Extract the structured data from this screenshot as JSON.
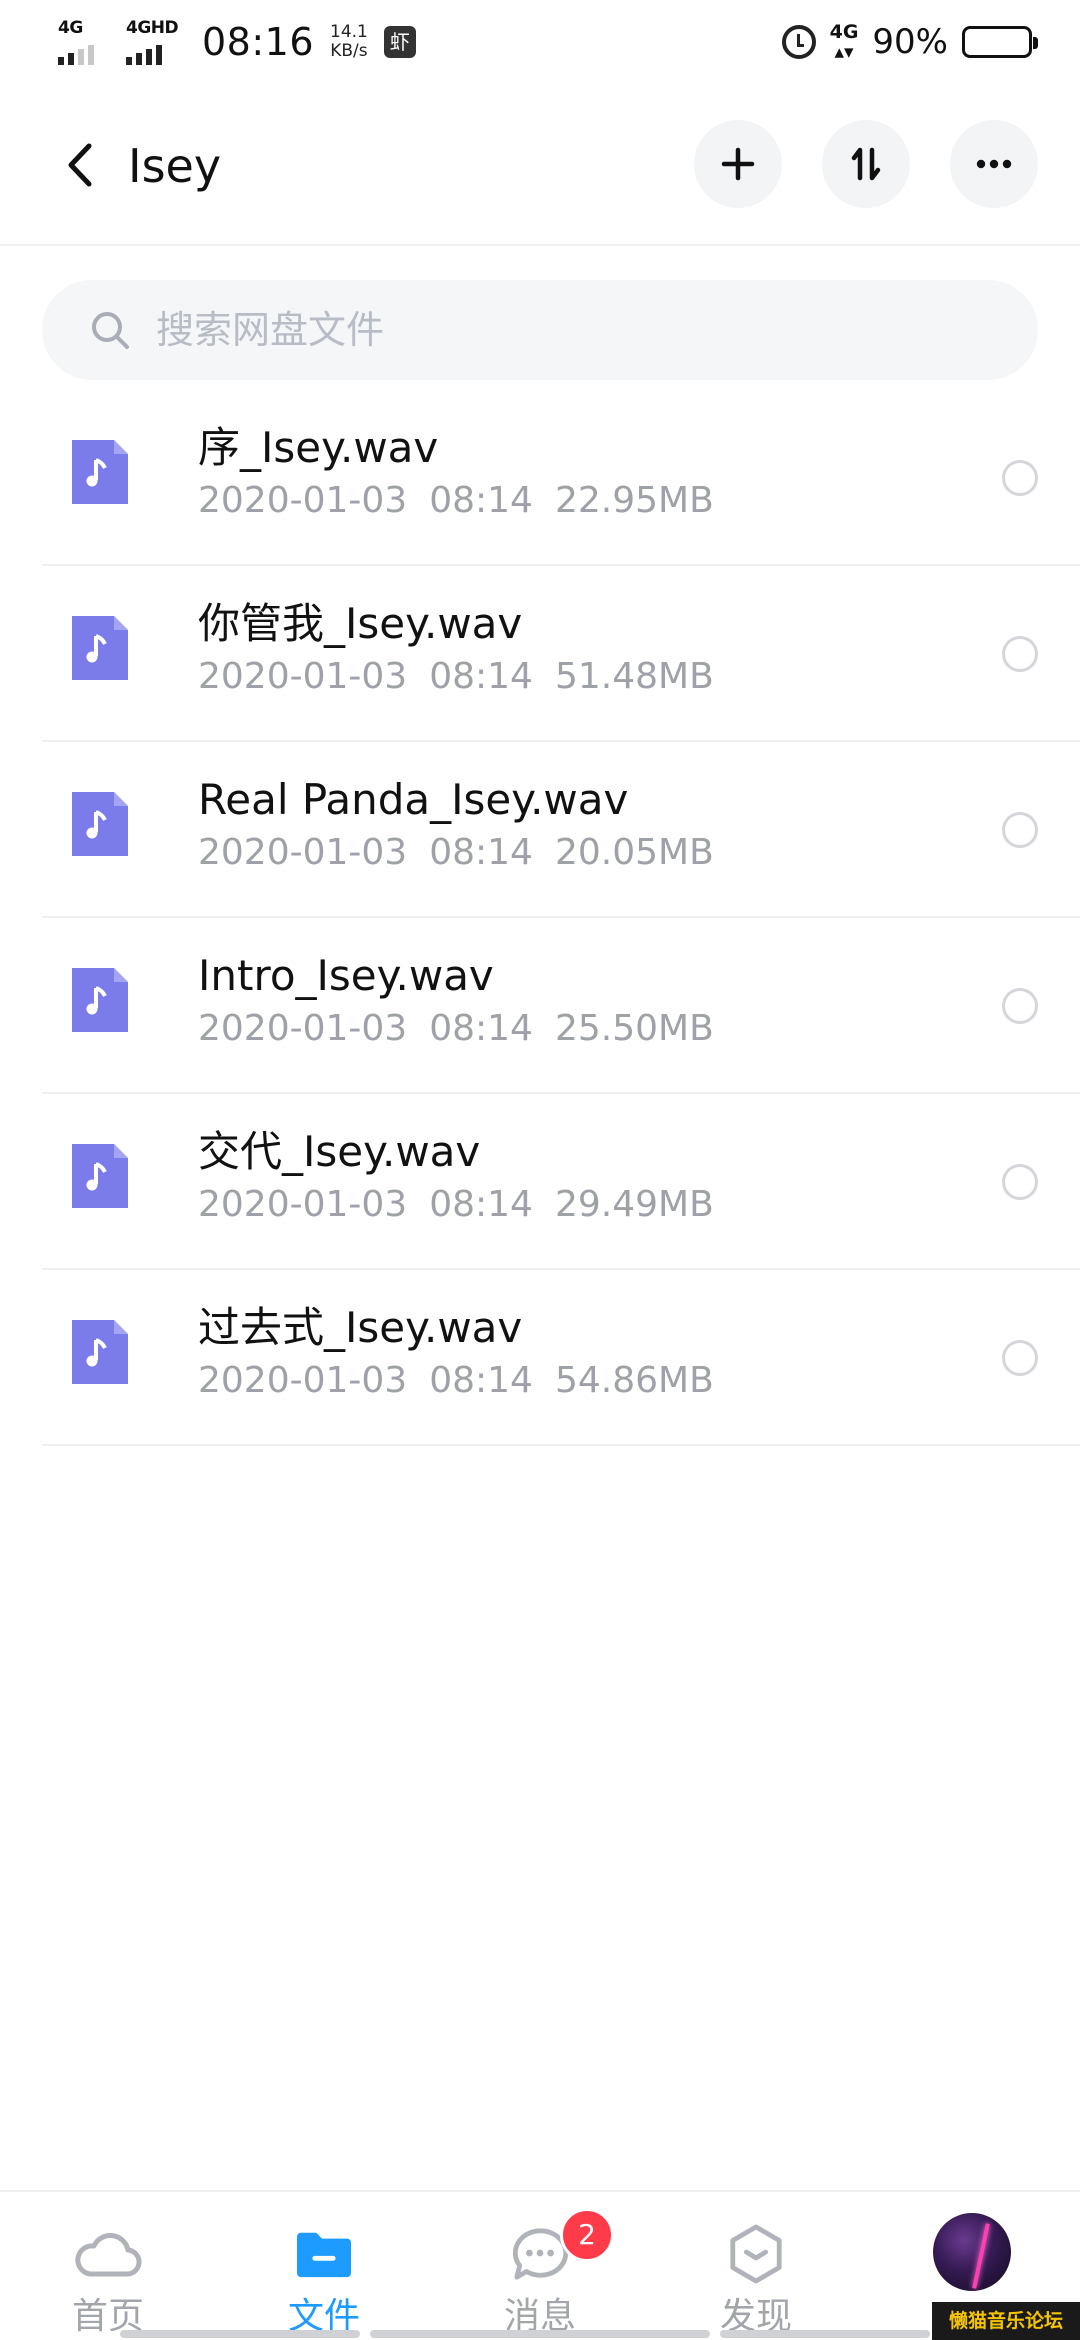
{
  "status_bar": {
    "network_1": "4G",
    "network_2": "4GHD",
    "time": "08:16",
    "speed_value": "14.1",
    "speed_unit": "KB/s",
    "app_glyph": "虾",
    "network_right": "4G",
    "battery_percent": "90%",
    "battery_level": 0.9
  },
  "header": {
    "back_icon": "chevron-left-icon",
    "title": "Isey",
    "actions": [
      "plus-icon",
      "sort-icon",
      "more-icon"
    ]
  },
  "search": {
    "placeholder": "搜索网盘文件",
    "value": ""
  },
  "files": [
    {
      "name": "序_Isey.wav",
      "date": "2020-01-03",
      "time": "08:14",
      "size": "22.95MB"
    },
    {
      "name": "你管我_Isey.wav",
      "date": "2020-01-03",
      "time": "08:14",
      "size": "51.48MB"
    },
    {
      "name": "Real Panda_Isey.wav",
      "date": "2020-01-03",
      "time": "08:14",
      "size": "20.05MB"
    },
    {
      "name": "Intro_Isey.wav",
      "date": "2020-01-03",
      "time": "08:14",
      "size": "25.50MB"
    },
    {
      "name": "交代_Isey.wav",
      "date": "2020-01-03",
      "time": "08:14",
      "size": "29.49MB"
    },
    {
      "name": "过去式_Isey.wav",
      "date": "2020-01-03",
      "time": "08:14",
      "size": "54.86MB"
    }
  ],
  "tabbar": {
    "tabs": [
      {
        "label": "首页",
        "icon": "cloud-icon",
        "active": false
      },
      {
        "label": "文件",
        "icon": "folder-icon",
        "active": true
      },
      {
        "label": "消息",
        "icon": "chat-icon",
        "active": false,
        "badge": "2"
      },
      {
        "label": "发现",
        "icon": "hexagon-icon",
        "active": false
      },
      {
        "label": "",
        "icon": "avatar",
        "active": false
      }
    ]
  },
  "colors": {
    "accent": "#1e9bff",
    "file_icon": "#7b7bea",
    "badge": "#ff3b4a",
    "meta_text": "#9ea1a8"
  },
  "watermark": "懒猫音乐论坛"
}
